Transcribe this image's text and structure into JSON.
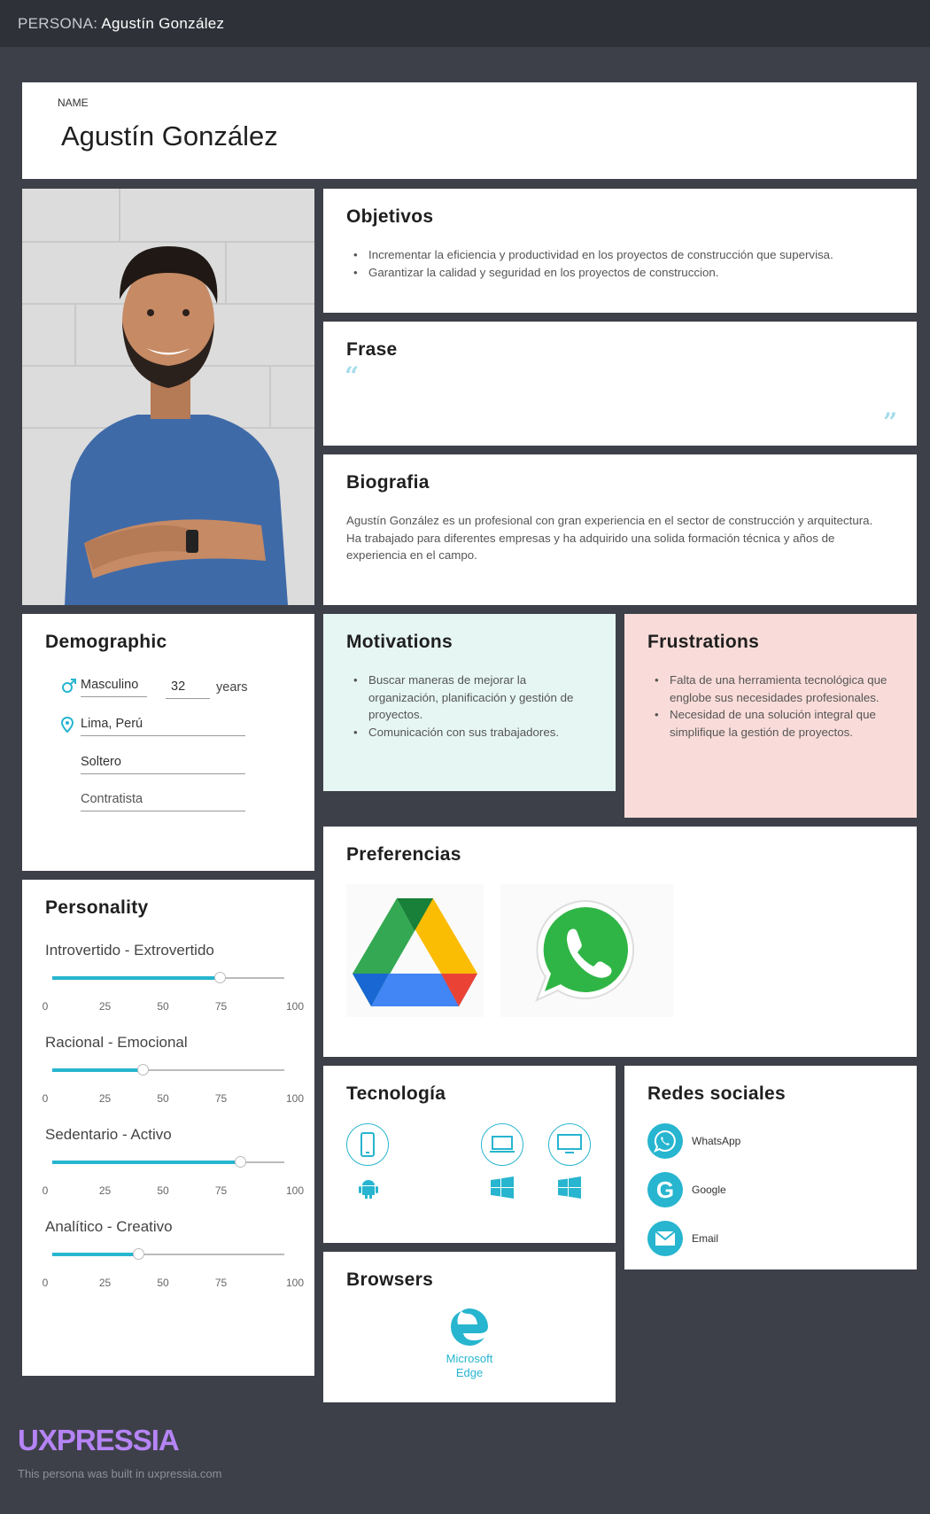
{
  "topbar": {
    "prefix": "PERSONA:",
    "name": "Agustín González"
  },
  "name_card": {
    "label": "NAME",
    "value": "Agustín González"
  },
  "objetivos": {
    "title": "Objetivos",
    "items": [
      "Incrementar la eficiencia y productividad en los proyectos de construcción que supervisa.",
      "Garantizar la calidad y seguridad en los proyectos de construccion."
    ]
  },
  "frase": {
    "title": "Frase",
    "open_quote": "“",
    "close_quote": "”"
  },
  "biografia": {
    "title": "Biografia",
    "text": "Agustín González es un profesional con gran experiencia en el sector de construcción y arquitectura. Ha trabajado para diferentes empresas y ha adquirido una solida formación técnica y años de experiencia en el campo."
  },
  "demographic": {
    "title": "Demographic",
    "gender": "Masculino",
    "age": "32",
    "age_unit": "years",
    "location": "Lima, Perú",
    "status": "Soltero",
    "occupation": "Contratista",
    "icons": [
      "male-icon",
      "location-pin-icon"
    ]
  },
  "motivations": {
    "title": "Motivations",
    "items": [
      "Buscar maneras de mejorar la organización, planificación y gestión de proyectos.",
      "Comunicación con sus trabajadores."
    ]
  },
  "frustrations": {
    "title": "Frustrations",
    "items": [
      "Falta de una herramienta tecnológica que englobe sus necesidades profesionales.",
      "Necesidad de una solución integral que simplifique la gestión de proyectos."
    ]
  },
  "preferencias": {
    "title": "Preferencias",
    "logos": [
      "google-drive-logo",
      "whatsapp-logo"
    ]
  },
  "personality": {
    "title": "Personality",
    "ticks": [
      "0",
      "25",
      "50",
      "75",
      "100"
    ],
    "traits": [
      {
        "label": "Introvertido - Extrovertido",
        "value": 72
      },
      {
        "label": "Racional - Emocional",
        "value": 39
      },
      {
        "label": "Sedentario - Activo",
        "value": 81
      },
      {
        "label": "Analítico - Creativo",
        "value": 37
      }
    ]
  },
  "tecnologia": {
    "title": "Tecnología",
    "devices": [
      {
        "device": "phone-icon",
        "os": "android-icon"
      },
      {
        "device": "laptop-icon",
        "os": "windows-icon"
      },
      {
        "device": "desktop-icon",
        "os": "windows-icon"
      }
    ]
  },
  "redes": {
    "title": "Redes sociales",
    "items": [
      {
        "label": "WhatsApp",
        "icon": "whatsapp-icon"
      },
      {
        "label": "Google",
        "icon": "google-icon"
      },
      {
        "label": "Email",
        "icon": "email-icon"
      }
    ]
  },
  "browsers": {
    "title": "Browsers",
    "items": [
      {
        "label": "Microsoft Edge",
        "icon": "edge-icon"
      }
    ]
  },
  "footer": {
    "brand": "UXPRESSIA",
    "note": "This persona was built in uxpressia.com"
  },
  "colors": {
    "accent": "#27b5cf",
    "motivations_bg": "#e6f6f2",
    "frustrations_bg": "#f9dcd9",
    "page_bg": "#3e4049",
    "brand": "#b584f5"
  }
}
